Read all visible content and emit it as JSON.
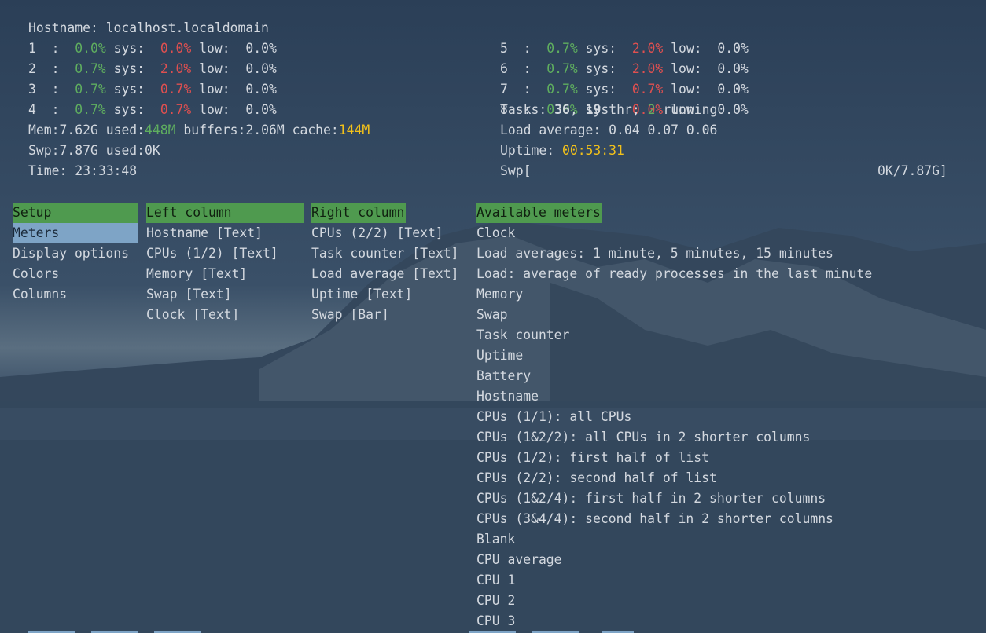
{
  "header_left": {
    "hostname_label": "Hostname:",
    "hostname": "localhost.localdomain",
    "cpus": [
      {
        "id": "1",
        "user": "0.0%",
        "sys": "0.0%",
        "low": "0.0%"
      },
      {
        "id": "2",
        "user": "0.7%",
        "sys": "2.0%",
        "low": "0.0%"
      },
      {
        "id": "3",
        "user": "0.7%",
        "sys": "0.7%",
        "low": "0.0%"
      },
      {
        "id": "4",
        "user": "0.7%",
        "sys": "0.7%",
        "low": "0.0%"
      }
    ],
    "sys_label": "sys:",
    "low_label": "low:",
    "mem": {
      "label": "Mem:",
      "total": "7.62G",
      "used_label": "used:",
      "used": "448M",
      "buffers_label": "buffers:",
      "buffers": "2.06M",
      "cache_label": "cache:",
      "cache": "144M"
    },
    "swp": {
      "label": "Swp:",
      "total": "7.87G",
      "used_label": "used:",
      "used": "0K"
    },
    "time": {
      "label": "Time:",
      "value": "23:33:48"
    }
  },
  "header_right": {
    "cpus": [
      {
        "id": "5",
        "user": "0.7%",
        "sys": "2.0%",
        "low": "0.0%"
      },
      {
        "id": "6",
        "user": "0.7%",
        "sys": "2.0%",
        "low": "0.0%"
      },
      {
        "id": "7",
        "user": "0.7%",
        "sys": "0.7%",
        "low": "0.0%"
      },
      {
        "id": "8",
        "user": "0.0%",
        "sys": "0.0%",
        "low": "0.0%"
      }
    ],
    "tasks": {
      "label": "Tasks:",
      "count": "36",
      "thr": "19",
      "thr_label": "thr;",
      "running": "2",
      "running_label": "running"
    },
    "load": {
      "label": "Load average:",
      "v1": "0.04",
      "v5": "0.07",
      "v15": "0.06"
    },
    "uptime": {
      "label": "Uptime:",
      "value": "00:53:31"
    },
    "swap_bar": {
      "label": "Swp[",
      "value": "0K/7.87G]",
      "fraction": 0.0
    }
  },
  "setup": {
    "header": "Setup",
    "items": [
      "Meters",
      "Display options",
      "Colors",
      "Columns"
    ],
    "selected": "Meters"
  },
  "left_column": {
    "header": "Left column",
    "items": [
      {
        "name": "Hostname",
        "mode": "[Text]"
      },
      {
        "name": "CPUs (1/2)",
        "mode": "[Text]"
      },
      {
        "name": "Memory",
        "mode": "[Text]"
      },
      {
        "name": "Swap",
        "mode": "[Text]"
      },
      {
        "name": "Clock",
        "mode": "[Text]"
      }
    ]
  },
  "right_column": {
    "header": "Right column",
    "items": [
      {
        "name": "CPUs (2/2)",
        "mode": "[Text]"
      },
      {
        "name": "Task counter",
        "mode": "[Text]"
      },
      {
        "name": "Load average",
        "mode": "[Text]"
      },
      {
        "name": "Uptime",
        "mode": "[Text]"
      },
      {
        "name": "Swap",
        "mode": "[Bar]"
      }
    ]
  },
  "available_meters": {
    "header": "Available meters",
    "items": [
      "Clock",
      "Load averages: 1 minute, 5 minutes, 15 minutes",
      "Load: average of ready processes in the last minute",
      "Memory",
      "Swap",
      "Task counter",
      "Uptime",
      "Battery",
      "Hostname",
      "CPUs (1/1): all CPUs",
      "CPUs (1&2/2): all CPUs in 2 shorter columns",
      "CPUs (1/2): first half of list",
      "CPUs (2/2): second half of list",
      "CPUs (1&2/4): first half in 2 shorter columns",
      "CPUs (3&4/4): second half in 2 shorter columns",
      "Blank",
      "CPU average",
      "CPU 1",
      "CPU 2",
      "CPU 3"
    ]
  },
  "colors": {
    "green": "#5fae5f",
    "red": "#e05050",
    "yellow": "#f2c11a",
    "header_bg": "#4f9a4f",
    "selection_bg": "#7ea4c6"
  }
}
